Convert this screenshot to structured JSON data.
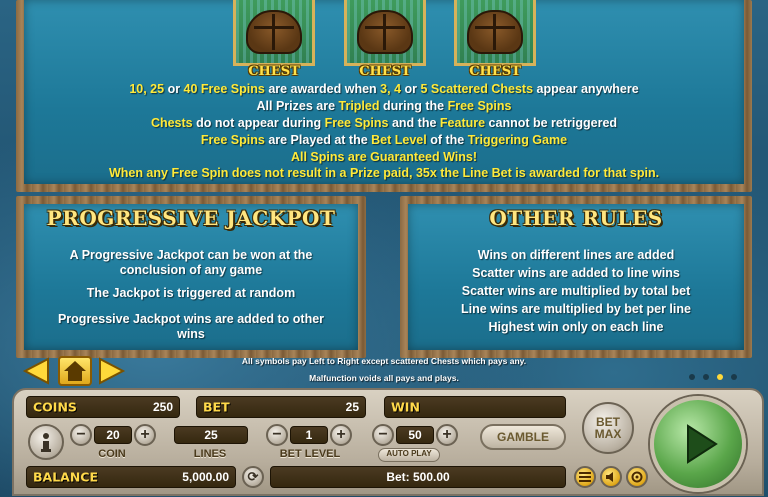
{
  "top_panel": {
    "chests": [
      "CHEST",
      "CHEST",
      "CHEST"
    ],
    "rules": [
      [
        {
          "t": "10, 25",
          "y": true
        },
        {
          "t": " or ",
          "y": false
        },
        {
          "t": "40 Free Spins",
          "y": true
        },
        {
          "t": " are awarded when ",
          "y": false
        },
        {
          "t": "3, 4",
          "y": true
        },
        {
          "t": " or ",
          "y": false
        },
        {
          "t": "5 Scattered Chests",
          "y": true
        },
        {
          "t": " appear anywhere",
          "y": false
        }
      ],
      [
        {
          "t": "All Prizes are ",
          "y": false
        },
        {
          "t": "Tripled",
          "y": true
        },
        {
          "t": " during the ",
          "y": false
        },
        {
          "t": "Free Spins",
          "y": true
        }
      ],
      [
        {
          "t": "Chests",
          "y": true
        },
        {
          "t": " do not appear during ",
          "y": false
        },
        {
          "t": "Free Spins",
          "y": true
        },
        {
          "t": " and the ",
          "y": false
        },
        {
          "t": "Feature",
          "y": true
        },
        {
          "t": " cannot be retriggered",
          "y": false
        }
      ],
      [
        {
          "t": "Free Spins",
          "y": true
        },
        {
          "t": " are Played at the ",
          "y": false
        },
        {
          "t": "Bet Level",
          "y": true
        },
        {
          "t": " of the ",
          "y": false
        },
        {
          "t": "Triggering Game",
          "y": true
        }
      ],
      [
        {
          "t": "All Spins are Guaranteed Wins!",
          "y": true
        }
      ],
      [
        {
          "t": "When any Free Spin does not result in a Prize paid, 35x the Line Bet is awarded for that spin.",
          "y": true
        }
      ]
    ]
  },
  "progressive": {
    "title": "PROGRESSIVE JACKPOT",
    "p1": "A Progressive Jackpot can be won at the conclusion of any game",
    "p2": "The Jackpot is triggered at random",
    "p3": "Progressive Jackpot wins are added to other wins"
  },
  "other_rules": {
    "title": "OTHER RULES",
    "lines": [
      "Wins on different lines are added",
      "Scatter wins are added to line wins",
      "Scatter wins are multiplied by total bet",
      "Line wins are multiplied by bet per line",
      "Highest win only on each line"
    ]
  },
  "footnotes": {
    "line1": "All symbols pay Left to Right except scattered Chests which pays any.",
    "line2": "Malfunction voids all pays and plays."
  },
  "console": {
    "coins_label": "COINS",
    "coins_value": "250",
    "bet_label": "BET",
    "bet_value": "25",
    "win_label": "WIN",
    "win_value": "",
    "coin_value": "20",
    "coin_label": "COIN",
    "lines_value": "25",
    "lines_label": "LINES",
    "bet_level_value": "1",
    "bet_level_label": "BET LEVEL",
    "autoplay_value": "50",
    "autoplay_label": "AUTO PLAY",
    "gamble_label": "GAMBLE",
    "bet_max_label": "BET MAX",
    "balance_label": "BALANCE",
    "balance_value": "5,000.00",
    "bet_total": "Bet: 500.00"
  },
  "colors": {
    "highlight": "#ffea3a",
    "panel": "#1d7898",
    "spin": "#5aa64a"
  }
}
